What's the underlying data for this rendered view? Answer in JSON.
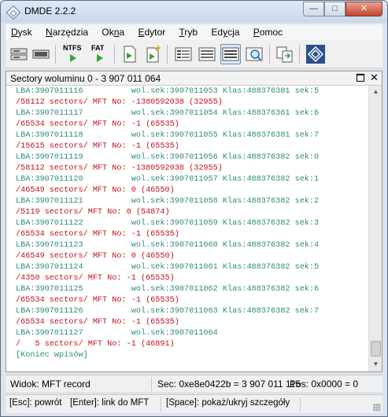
{
  "window": {
    "title": "DMDE 2.2.2",
    "min_glyph": "—",
    "max_glyph": "□",
    "close_glyph": "✕"
  },
  "menu": [
    {
      "label_pre": "",
      "hot": "D",
      "label_post": "ysk"
    },
    {
      "label_pre": "",
      "hot": "N",
      "label_post": "arzędzia"
    },
    {
      "label_pre": "Ok",
      "hot": "n",
      "label_post": "a"
    },
    {
      "label_pre": "",
      "hot": "E",
      "label_post": "dytor"
    },
    {
      "label_pre": "",
      "hot": "T",
      "label_post": "ryb"
    },
    {
      "label_pre": "Ed",
      "hot": "y",
      "label_post": "cja"
    },
    {
      "label_pre": "",
      "hot": "P",
      "label_post": "omoc"
    }
  ],
  "toolbar": {
    "ntfs_label": "NTFS",
    "fat_label": "FAT",
    "icons": [
      "drive-icon",
      "partitions-icon",
      "ntfs-icon",
      "fat-icon",
      "file-icon",
      "new-file-icon",
      "list-view-icon",
      "details-view-icon",
      "table-view-icon",
      "search-view-icon",
      "copy-icon",
      "dmde-logo-icon"
    ]
  },
  "panel": {
    "title": "Sectory woluminu 0 - 3 907 011 064",
    "max_glyph": "",
    "close_glyph": "✕"
  },
  "listing": [
    {
      "text": "LBA:3907011116          wol.sek:3907011053 Klas:488376381 sek:5",
      "color": "green"
    },
    {
      "text": "/58112 sectors/ MFT No: -1380592038 (32955)",
      "color": "red"
    },
    {
      "text": "LBA:3907011117          wol.sek:3907011054 Klas:488376381 sek:6",
      "color": "green"
    },
    {
      "text": "/65534 sectors/ MFT No: -1 (65535)",
      "color": "red"
    },
    {
      "text": "LBA:3907011118          wol.sek:3907011055 Klas:488376381 sek:7",
      "color": "green"
    },
    {
      "text": "/15615 sectors/ MFT No: -1 (65535)",
      "color": "red"
    },
    {
      "text": "LBA:3907011119          wol.sek:3907011056 Klas:488376382 sek:0",
      "color": "green"
    },
    {
      "text": "/58112 sectors/ MFT No: -1380592038 (32955)",
      "color": "red"
    },
    {
      "text": "LBA:3907011120          wol.sek:3907011057 Klas:488376382 sek:1",
      "color": "green"
    },
    {
      "text": "/46549 sectors/ MFT No: 0 (46550)",
      "color": "red"
    },
    {
      "text": "LBA:3907011121          wol.sek:3907011058 Klas:488376382 sek:2",
      "color": "green"
    },
    {
      "text": "/5119 sectors/ MFT No: 0 (54874)",
      "color": "red"
    },
    {
      "text": "LBA:3907011122          wol.sek:3907011059 Klas:488376382 sek:3",
      "color": "green"
    },
    {
      "text": "/65534 sectors/ MFT No: -1 (65535)",
      "color": "red"
    },
    {
      "text": "LBA:3907011123          wol.sek:3907011060 Klas:488376382 sek:4",
      "color": "green"
    },
    {
      "text": "/46549 sectors/ MFT No: 0 (46550)",
      "color": "red"
    },
    {
      "text": "LBA:3907011124          wol.sek:3907011061 Klas:488376382 sek:5",
      "color": "green"
    },
    {
      "text": "/4350 sectors/ MFT No: -1 (65535)",
      "color": "red"
    },
    {
      "text": "LBA:3907011125          wol.sek:3907011062 Klas:488376382 sek:6",
      "color": "green"
    },
    {
      "text": "/65534 sectors/ MFT No: -1 (65535)",
      "color": "red"
    },
    {
      "text": "LBA:3907011126          wol.sek:3907011063 Klas:488376382 sek:7",
      "color": "green"
    },
    {
      "text": "/65534 sectors/ MFT No: -1 (65535)",
      "color": "red"
    },
    {
      "text": "LBA:3907011127          wol.sek:3907011064",
      "color": "green"
    },
    {
      "text": "/   5 sectors/ MFT No: -1 (46891)",
      "color": "red"
    },
    {
      "text": "[Koniec wpisów]",
      "color": "green"
    }
  ],
  "status": {
    "view": "Widok: MFT record",
    "sector": "Sec: 0xe8e0422b = 3 907 011 115",
    "position": "Pos: 0x0000 = 0"
  },
  "hints": {
    "back": "[Esc]: powrót",
    "link": "[Enter]: link do MFT",
    "details": "[Space]: pokaż/ukryj szczegóły"
  },
  "colors": {
    "green_text": "#2e8b7a",
    "red_text": "#c0121a",
    "accent": "#3b5b86"
  }
}
